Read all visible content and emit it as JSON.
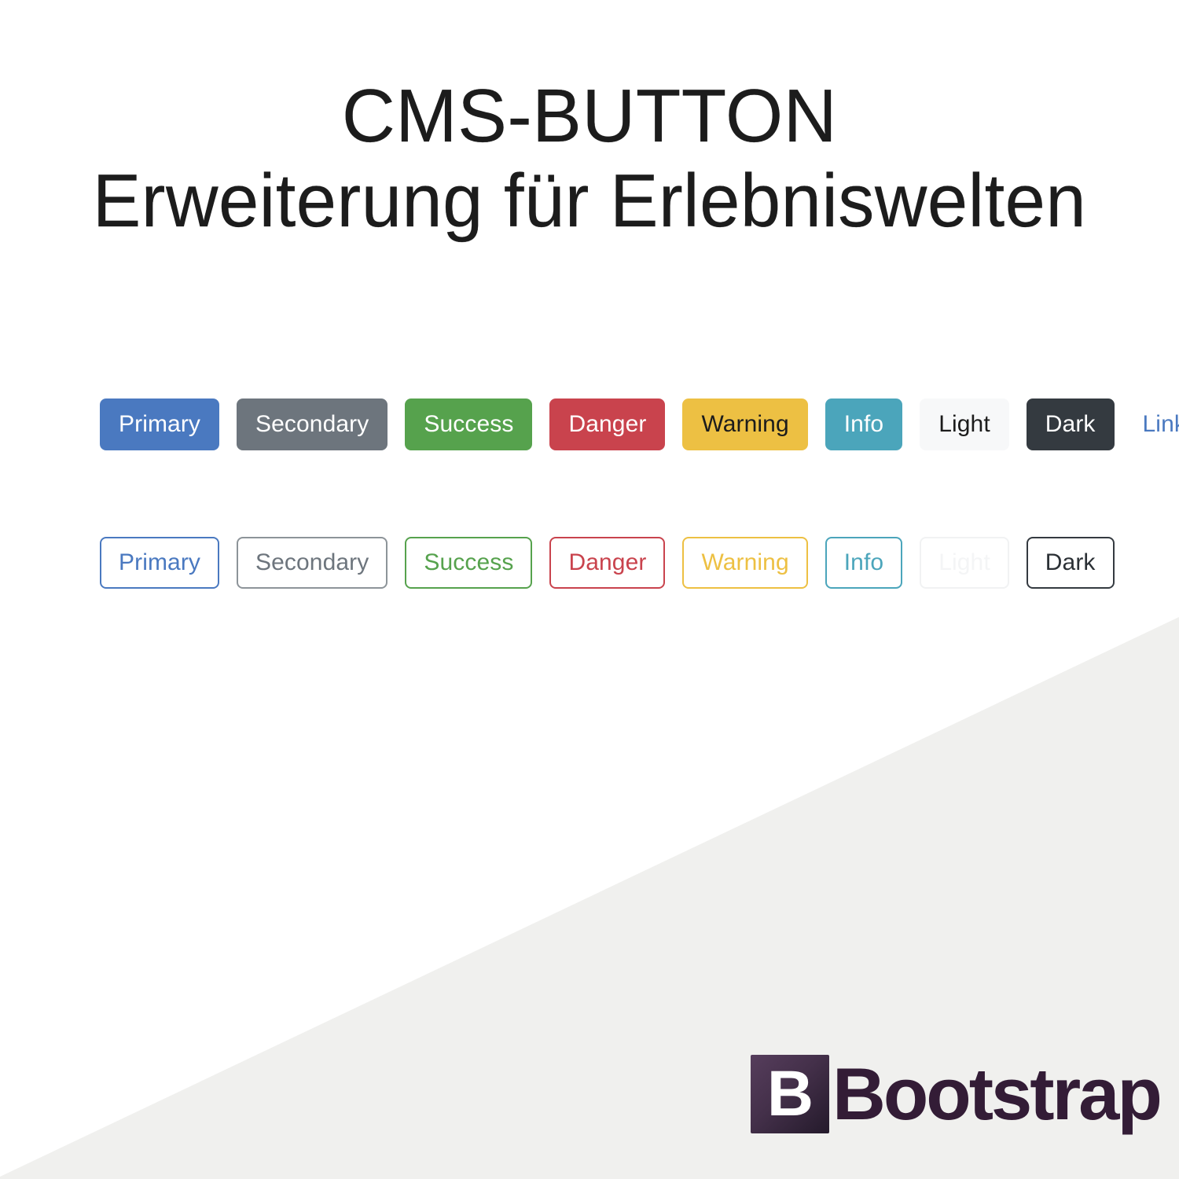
{
  "page": {
    "background_color": "#ffffff",
    "wedge_color": "#f0f0ee"
  },
  "heading": {
    "line1": "CMS-BUTTON",
    "line2": "Erweiterung für Erlebniswelten"
  },
  "button_rows": {
    "solid": {
      "name": "solid-buttons",
      "buttons": [
        {
          "label": "Primary",
          "variant": "primary",
          "bg": "#4a79c0",
          "fg": "#ffffff"
        },
        {
          "label": "Secondary",
          "variant": "secondary",
          "bg": "#6d757d",
          "fg": "#ffffff"
        },
        {
          "label": "Success",
          "variant": "success",
          "bg": "#56a24d",
          "fg": "#ffffff"
        },
        {
          "label": "Danger",
          "variant": "danger",
          "bg": "#c9434d",
          "fg": "#ffffff"
        },
        {
          "label": "Warning",
          "variant": "warning",
          "bg": "#edc043",
          "fg": "#1c1c1c"
        },
        {
          "label": "Info",
          "variant": "info",
          "bg": "#4ba5bb",
          "fg": "#ffffff"
        },
        {
          "label": "Light",
          "variant": "light",
          "bg": "#f7f8f9",
          "fg": "#1c1c1c"
        },
        {
          "label": "Dark",
          "variant": "dark",
          "bg": "#343a40",
          "fg": "#ffffff"
        },
        {
          "label": "Link",
          "variant": "link",
          "bg": "transparent",
          "fg": "#4a79c0"
        }
      ]
    },
    "outline": {
      "name": "outline-buttons",
      "buttons": [
        {
          "label": "Primary",
          "variant": "outline-primary",
          "border": "#4a79c0",
          "fg": "#4a79c0"
        },
        {
          "label": "Secondary",
          "variant": "outline-secondary",
          "border": "#8d9499",
          "fg": "#6d757d"
        },
        {
          "label": "Success",
          "variant": "outline-success",
          "border": "#56a24d",
          "fg": "#56a24d"
        },
        {
          "label": "Danger",
          "variant": "outline-danger",
          "border": "#c9434d",
          "fg": "#c9434d"
        },
        {
          "label": "Warning",
          "variant": "outline-warning",
          "border": "#edc043",
          "fg": "#edc043"
        },
        {
          "label": "Info",
          "variant": "outline-info",
          "border": "#4ba5bb",
          "fg": "#4ba5bb"
        },
        {
          "label": "Light",
          "variant": "outline-light",
          "border": "#f1f2f3",
          "fg": "#f4f5f6"
        },
        {
          "label": "Dark",
          "variant": "outline-dark",
          "border": "#343a40",
          "fg": "#2b3035"
        }
      ]
    }
  },
  "logo": {
    "mark_letter": "B",
    "wordmark": "Bootstrap",
    "mark_gradient_from": "#563d5c",
    "mark_gradient_to": "#241a2b",
    "wordmark_color": "#331c36"
  }
}
